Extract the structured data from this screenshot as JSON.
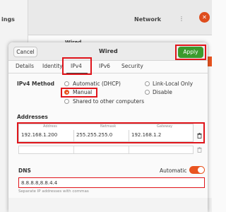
{
  "background": {
    "sidebar_label": "ings",
    "window_title": "Network",
    "menu_dots": "⋮",
    "close_glyph": "✕",
    "section_label": "Wired"
  },
  "dialog": {
    "title": "Wired",
    "cancel_label": "Cancel",
    "apply_label": "Apply"
  },
  "tabs": [
    "Details",
    "Identity",
    "IPv4",
    "IPv6",
    "Security"
  ],
  "active_tab": "IPv4",
  "ipv4": {
    "method_label": "IPv4 Method",
    "options": [
      {
        "label": "Automatic (DHCP)",
        "selected": false
      },
      {
        "label": "Link-Local Only",
        "selected": false
      },
      {
        "label": "Manual",
        "selected": true
      },
      {
        "label": "Disable",
        "selected": false
      },
      {
        "label": "Shared to other computers",
        "selected": false
      }
    ]
  },
  "addresses": {
    "section_label": "Addresses",
    "columns": [
      "Address",
      "Netmask",
      "Gateway"
    ],
    "rows": [
      {
        "address": "192.168.1.200",
        "netmask": "255.255.255.0",
        "gateway": "192.168.1.2"
      }
    ]
  },
  "dns": {
    "label": "DNS",
    "automatic_label": "Automatic",
    "automatic_on": true,
    "value": "8.8.8.8,8.8.4.4",
    "hint": "Separate IP addresses with commas"
  },
  "colors": {
    "accent": "#e95420",
    "apply_green": "#3b9a2c",
    "highlight_red": "#e0151b"
  }
}
